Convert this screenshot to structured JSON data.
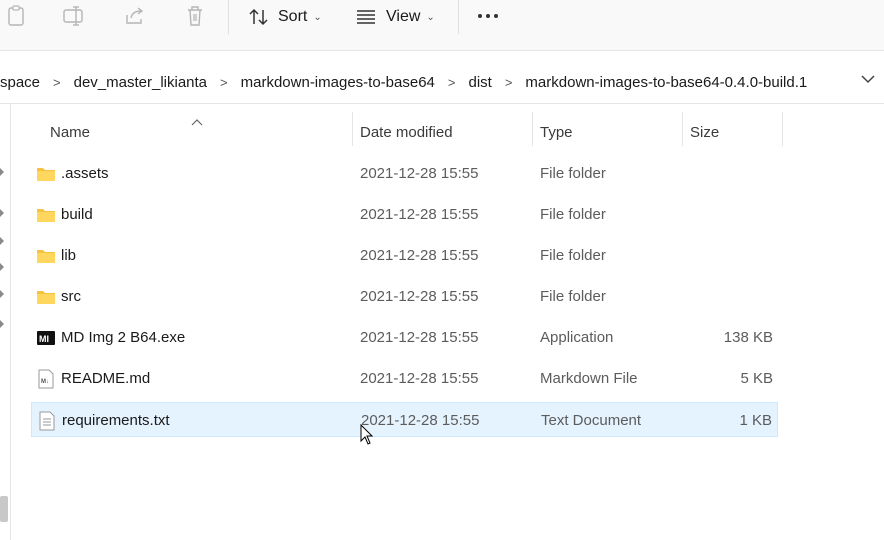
{
  "toolbar": {
    "sort_label": "Sort",
    "view_label": "View",
    "icons": [
      "paste-icon",
      "rename-icon",
      "share-icon",
      "delete-icon",
      "sort-icon",
      "view-icon",
      "more-icon"
    ]
  },
  "breadcrumb": {
    "items": [
      {
        "label": "space"
      },
      {
        "label": "dev_master_likianta"
      },
      {
        "label": "markdown-images-to-base64"
      },
      {
        "label": "dist"
      },
      {
        "label": "markdown-images-to-base64-0.4.0-build.1"
      }
    ],
    "separator": ">"
  },
  "columns": {
    "name": "Name",
    "date": "Date modified",
    "type": "Type",
    "size": "Size"
  },
  "files": [
    {
      "name": ".assets",
      "date": "2021-12-28 15:55",
      "type": "File folder",
      "size": "",
      "icon": "folder-icon"
    },
    {
      "name": "build",
      "date": "2021-12-28 15:55",
      "type": "File folder",
      "size": "",
      "icon": "folder-icon"
    },
    {
      "name": "lib",
      "date": "2021-12-28 15:55",
      "type": "File folder",
      "size": "",
      "icon": "folder-icon"
    },
    {
      "name": "src",
      "date": "2021-12-28 15:55",
      "type": "File folder",
      "size": "",
      "icon": "folder-icon"
    },
    {
      "name": "MD Img 2 B64.exe",
      "date": "2021-12-28 15:55",
      "type": "Application",
      "size": "138 KB",
      "icon": "app-icon"
    },
    {
      "name": "README.md",
      "date": "2021-12-28 15:55",
      "type": "Markdown File",
      "size": "5 KB",
      "icon": "markdown-file-icon"
    },
    {
      "name": "requirements.txt",
      "date": "2021-12-28 15:55",
      "type": "Text Document",
      "size": "1 KB",
      "icon": "text-file-icon",
      "selected": true
    }
  ],
  "colors": {
    "selection_bg": "#e5f3ff",
    "selection_border": "#cce8ff",
    "folder": "#f5c342"
  }
}
